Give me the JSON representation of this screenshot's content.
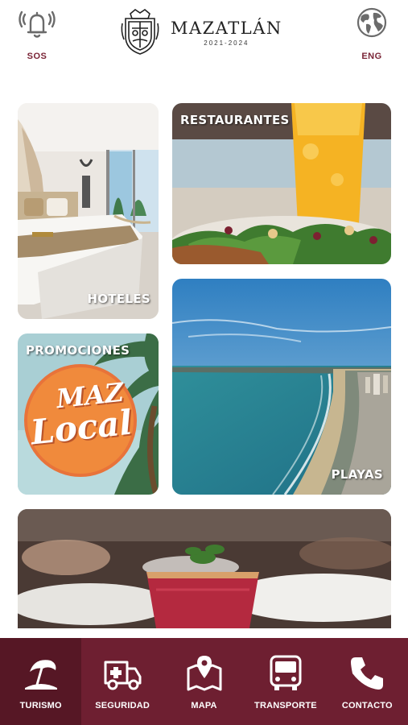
{
  "header": {
    "sos_label": "SOS",
    "lang_label": "ENG",
    "logo_name": "MAZATLÁN",
    "logo_years": "2021-2024"
  },
  "tiles": {
    "hoteles": "HOTELES",
    "restaurantes": "RESTAURANTES",
    "promociones": "PROMOCIONES",
    "promo_logo_line1": "MAZ",
    "promo_logo_line2": "Local",
    "playas": "PLAYAS"
  },
  "nav": {
    "items": [
      {
        "label": "TURISMO",
        "icon": "beach-umbrella-icon"
      },
      {
        "label": "SEGURIDAD",
        "icon": "ambulance-icon"
      },
      {
        "label": "MAPA",
        "icon": "map-pin-icon"
      },
      {
        "label": "TRANSPORTE",
        "icon": "bus-icon"
      },
      {
        "label": "CONTACTO",
        "icon": "phone-icon"
      }
    ],
    "active_index": 0
  },
  "colors": {
    "brand": "#6e1f31",
    "brand_active": "#561725",
    "accent_text": "#7a2436"
  }
}
